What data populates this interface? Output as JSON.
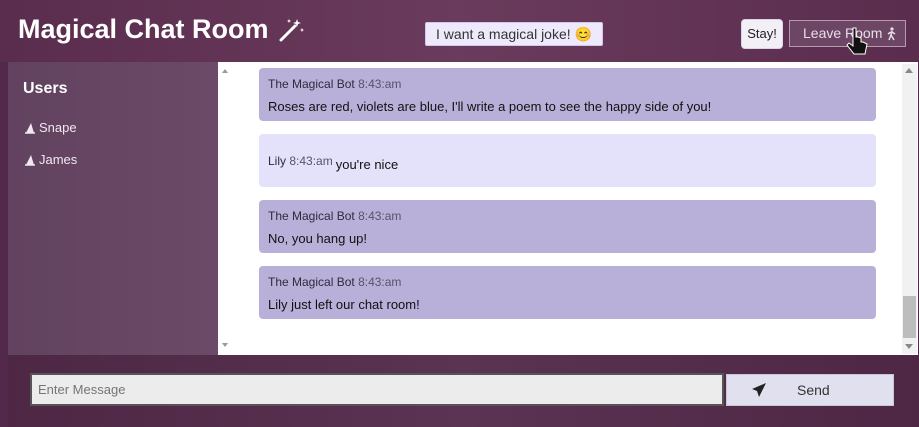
{
  "header": {
    "title": "Magical Chat Room",
    "joke_button": "I want a magical joke! 😊",
    "stay_button": "Stay!",
    "leave_button": "Leave Room"
  },
  "sidebar": {
    "heading": "Users",
    "users": [
      {
        "name": "Snape"
      },
      {
        "name": "James"
      }
    ]
  },
  "messages": [
    {
      "sender": "The Magical Bot",
      "time": "8:43:am",
      "text": "Roses are red, violets are blue, I'll write a poem to see the happy side of you!",
      "type": "bot"
    },
    {
      "sender": "Lily",
      "time": "8:43:am",
      "text": "you're nice",
      "type": "user"
    },
    {
      "sender": "The Magical Bot",
      "time": "8:43:am",
      "text": "No, you hang up!",
      "type": "bot"
    },
    {
      "sender": "The Magical Bot",
      "time": "8:43:am",
      "text": "Lily just left our chat room!",
      "type": "bot"
    }
  ],
  "composer": {
    "placeholder": "Enter Message",
    "send_label": "Send"
  },
  "colors": {
    "bot_bubble": "#b9b0d9",
    "user_bubble": "#e4e2fb",
    "header": "#5a2c4d"
  },
  "icons": {
    "title_icon": "magic-wand-icon",
    "user_icon": "wizard-hat-icon",
    "leave_icon": "walking-person-icon",
    "send_icon": "paper-plane-icon"
  }
}
